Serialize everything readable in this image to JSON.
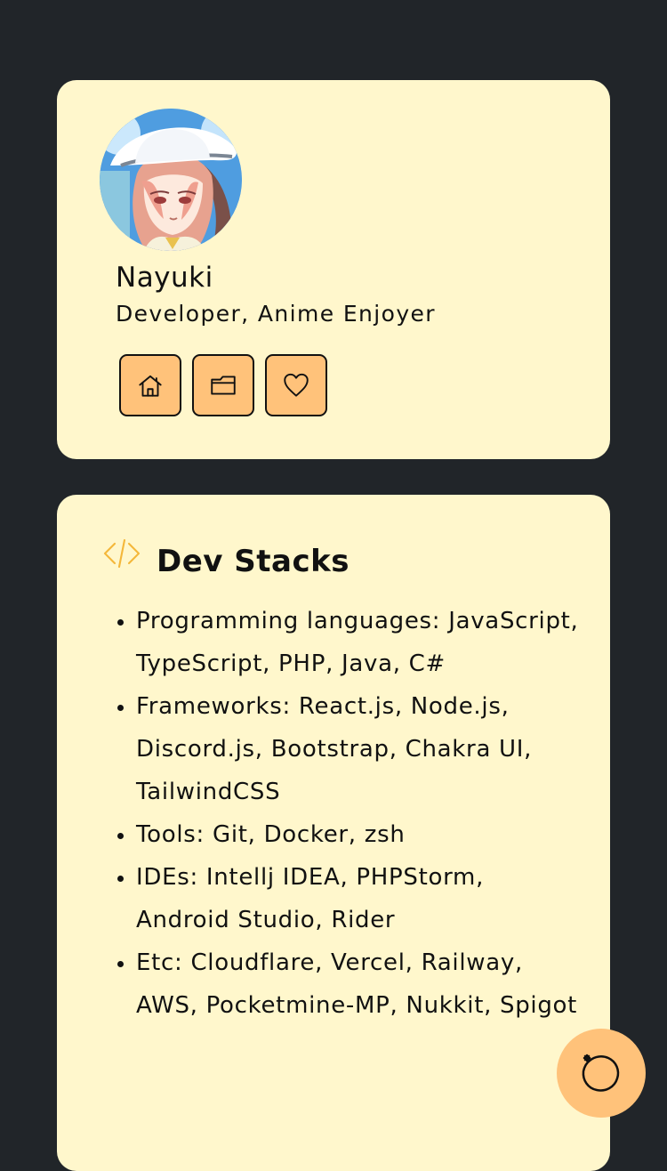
{
  "profile": {
    "name": "Nayuki",
    "role": "Developer, Anime Enjoyer"
  },
  "actions": [
    {
      "icon": "home-icon"
    },
    {
      "icon": "folder-icon"
    },
    {
      "icon": "heart-icon"
    }
  ],
  "dev_stacks": {
    "title": "Dev Stacks",
    "items": [
      "Programming languages: JavaScript, TypeScript, PHP, Java, C#",
      "Frameworks: React.js, Node.js, Discord.js, Bootstrap, Chakra UI, TailwindCSS",
      "Tools: Git, Docker, zsh",
      "IDEs: Intellj IDEA, PHPStorm, Android Studio, Rider",
      "Etc: Cloudflare, Vercel, Railway, AWS, Pocketmine-MP, Nukkit, Spigot"
    ]
  },
  "colors": {
    "background": "#212529",
    "card": "#fff7cc",
    "button": "#ffc27a",
    "accent": "#f4b73a"
  },
  "floating_action": {
    "icon": "refresh-sparkle-icon"
  }
}
